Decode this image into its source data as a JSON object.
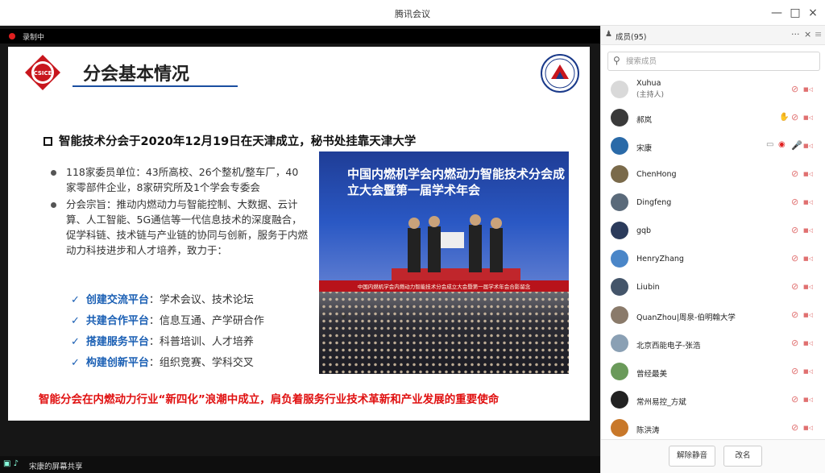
{
  "window": {
    "title": "腾讯会议",
    "minimize": "—",
    "maximize": "□",
    "close": "×"
  },
  "recording": {
    "label": "录制中"
  },
  "slide": {
    "title": "分会基本情况",
    "logo_left_text": "CSICE",
    "headline": "智能技术分会于2020年12月19日在天津成立，秘书处挂靠天津大学",
    "bullets": [
      "118家委员单位：43所高校、26个整机/整车厂，40家零部件企业，8家研究所及1个学会专委会",
      "分会宗旨：推动内燃动力与智能控制、大数据、云计算、人工智能、5G通信等一代信息技术的深度融合，促学科链、技术链与产业链的协同与创新，服务于内燃动力科技进步和人才培养，致力于："
    ],
    "platforms": [
      {
        "key": "创建交流平台",
        "desc": "：学术会议、技术论坛"
      },
      {
        "key": "共建合作平台",
        "desc": "：信息互通、产学研合作"
      },
      {
        "key": "搭建服务平台",
        "desc": "：科普培训、人才培养"
      },
      {
        "key": "构建创新平台",
        "desc": "：组织竞赛、学科交叉"
      }
    ],
    "photo_heading": "中国内燃机学会内燃动力智能技术分会成立大会暨第一届学术年会",
    "photo_caption": "中国内燃机学会内燃动力智能技术分会成立大会暨第一届学术年会合影留念",
    "bottom_line": "智能分会在内燃动力行业“新四化”浪潮中成立，肩负着服务行业技术革新和产业发展的重要使命"
  },
  "share": {
    "label": "宋康的屏幕共享"
  },
  "panel": {
    "title": "成员(95)",
    "more": "···",
    "close": "×",
    "menu": "≡",
    "search_placeholder": "搜索成员",
    "members": [
      {
        "name": "Xuhua",
        "role": "(主持人)",
        "avatar": "#d9d9d9"
      },
      {
        "name": "郝岚",
        "avatar": "#3a3a3a"
      },
      {
        "name": "宋康",
        "avatar": "#2a6aa8"
      },
      {
        "name": "ChenHong",
        "avatar": "#7a6a4a"
      },
      {
        "name": "Dingfeng",
        "avatar": "#5a6a7a"
      },
      {
        "name": "gqb",
        "avatar": "#2b3b5b"
      },
      {
        "name": "HenryZhang",
        "avatar": "#4a86c8"
      },
      {
        "name": "Liubin",
        "avatar": "#44556a"
      },
      {
        "name": "QuanZhou|周泉-伯明翰大学",
        "avatar": "#8a7a6a"
      },
      {
        "name": "北京西能电子-张浩",
        "avatar": "#8aa0b4"
      },
      {
        "name": "曾经最美",
        "avatar": "#6a9a5a"
      },
      {
        "name": "常州易控_方斌",
        "avatar": "#222222"
      },
      {
        "name": "陈洪涛",
        "avatar": "#c8782a"
      }
    ],
    "mute_all": "解除静音",
    "rename": "改名"
  }
}
